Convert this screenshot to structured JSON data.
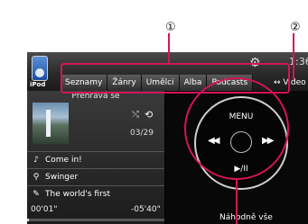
{
  "callouts": {
    "first": "①",
    "second": "②"
  },
  "header": {
    "source_label": "iPod",
    "gear_icon": "gear-icon",
    "top_count": "1:36",
    "tabs": [
      {
        "label": "Seznamy"
      },
      {
        "label": "Žánry"
      },
      {
        "label": "Umělci"
      },
      {
        "label": "Alba"
      },
      {
        "label": "Podcasts"
      }
    ],
    "video_tab": "↔ Video"
  },
  "now_playing": {
    "title": "Přehrává se",
    "track_count": "03/29",
    "song": "Come in!",
    "artist": "Swinger",
    "album": "The world's first",
    "elapsed": "00'01\"",
    "remaining": "-05'40\"",
    "progress_fraction": 0.01
  },
  "controls": {
    "menu": "MENU",
    "prev": "◀◀",
    "next": "▶▶",
    "play_pause": "▶/II",
    "shuffle_all": "Náhodně vše"
  },
  "colors": {
    "callout_accent": "#d4145a"
  }
}
